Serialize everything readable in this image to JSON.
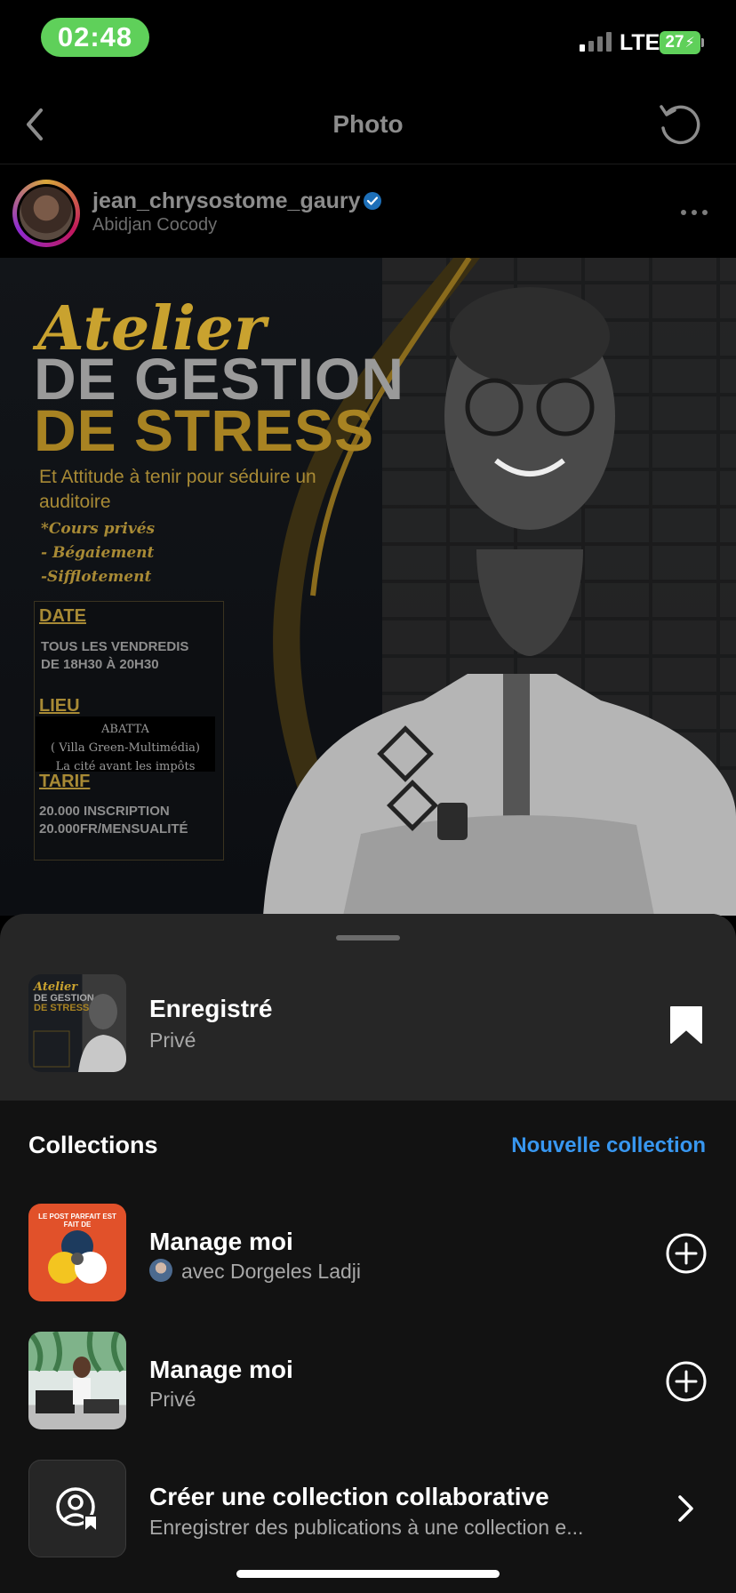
{
  "status": {
    "time": "02:48",
    "network": "LTE",
    "battery": "27"
  },
  "nav": {
    "title": "Photo"
  },
  "post": {
    "username": "jean_chrysostome_gaury",
    "location": "Abidjan Cocody",
    "poster": {
      "title_script": "Atelier",
      "title_line1": "DE GESTION",
      "title_line2": "DE STRESS",
      "subtitle": "Et Attitude à tenir pour séduire un auditoire",
      "bullets": [
        "*Cours privés",
        "- Bégaiement",
        "-Sifflotement"
      ],
      "date_label": "DATE",
      "date_value": [
        "TOUS LES VENDREDIS",
        "DE 18H30 À 20H30"
      ],
      "lieu_label": "LIEU",
      "lieu_value": [
        "ABATTA",
        "( Villa Green-Multimédia)",
        "La cité avant les impôts"
      ],
      "tarif_label": "TARIF",
      "tarif_value": [
        "20.000 INSCRIPTION",
        "20.000FR/MENSUALITÉ"
      ]
    }
  },
  "sheet": {
    "saved": {
      "title": "Enregistré",
      "subtitle": "Privé"
    },
    "collections_title": "Collections",
    "new_collection": "Nouvelle collection",
    "collections": [
      {
        "title": "Manage moi",
        "subtitle": "avec Dorgeles Ladji",
        "thumb_text": "LE POST PARFAIT EST FAIT DE"
      },
      {
        "title": "Manage moi",
        "subtitle": "Privé"
      }
    ],
    "create": {
      "title": "Créer une collection collaborative",
      "subtitle": "Enregistrer des publications à une collection e..."
    }
  },
  "colors": {
    "accent": "#3897f0",
    "time_pill": "#5fd05a",
    "poster_gold": "#c9a22f"
  }
}
